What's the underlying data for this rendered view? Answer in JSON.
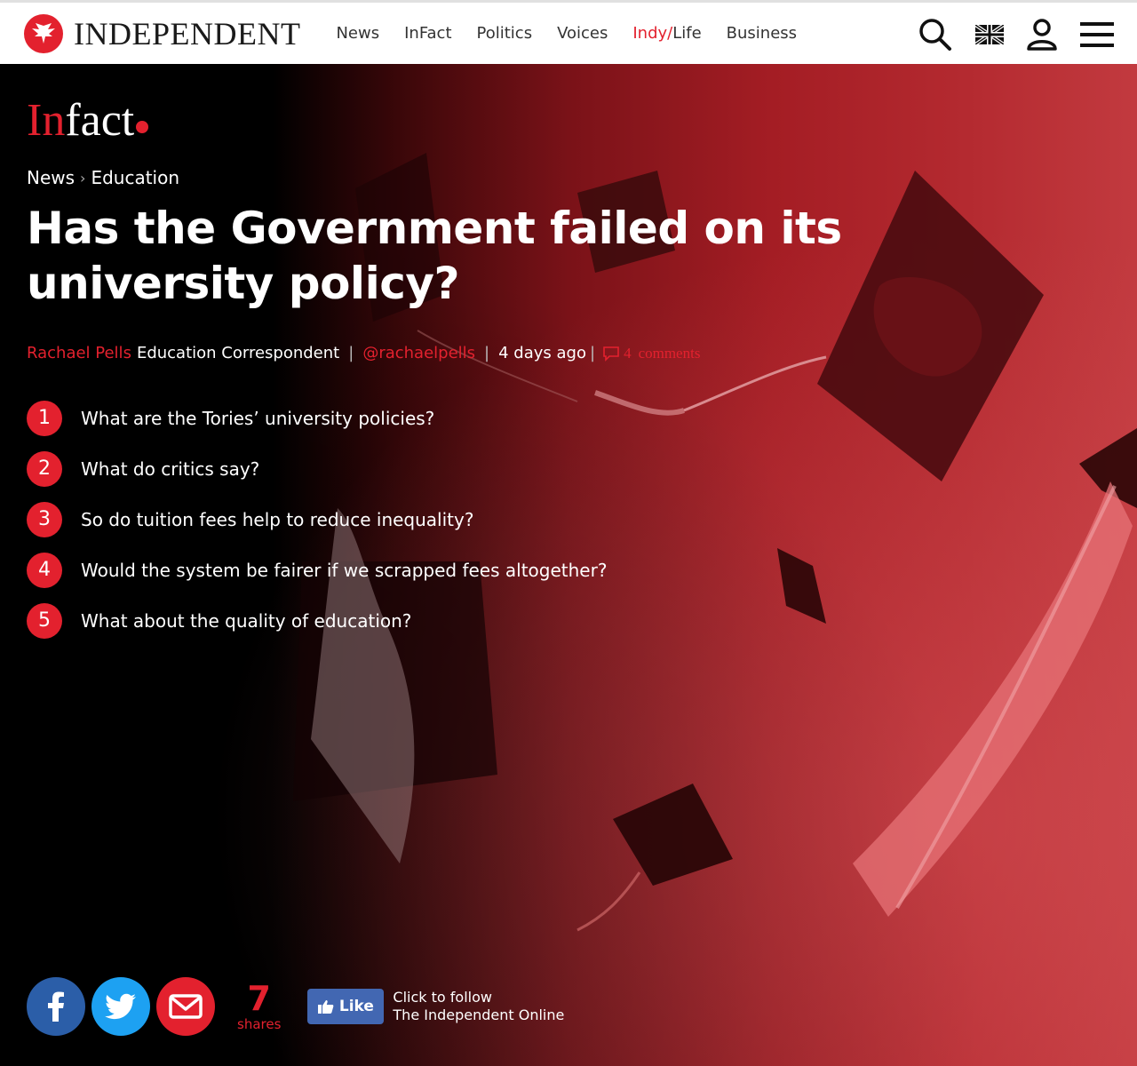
{
  "header": {
    "brand": "INDEPENDENT",
    "nav": [
      {
        "label": "News"
      },
      {
        "label": "InFact"
      },
      {
        "label": "Politics"
      },
      {
        "label": "Voices"
      },
      {
        "label_a": "Indy/",
        "label_b": "Life"
      },
      {
        "label": "Business"
      }
    ],
    "icons": [
      "search-icon",
      "uk-flag-icon",
      "user-icon",
      "menu-icon"
    ]
  },
  "infact_logo": {
    "red": "In",
    "rest": "fact"
  },
  "breadcrumb": {
    "section": "News",
    "sep": "›",
    "subsection": "Education"
  },
  "headline": "Has the Government failed on its university policy?",
  "byline": {
    "author": "Rachael Pells",
    "role": "Education Correspondent",
    "handle": "@rachaelpells",
    "time": "4 days ago",
    "comment_count": "4",
    "comment_label": "comments"
  },
  "toc": [
    {
      "num": "1",
      "text": "What are the Tories’ university policies?"
    },
    {
      "num": "2",
      "text": "What do critics say?"
    },
    {
      "num": "3",
      "text": "So do tuition fees help to reduce inequality?"
    },
    {
      "num": "4",
      "text": "Would the system be fairer if we scrapped fees altogether?"
    },
    {
      "num": "5",
      "text": "What about the quality of education?"
    }
  ],
  "share": {
    "count": "7",
    "label": "shares",
    "like": "Like",
    "follow_line1": "Click to follow",
    "follow_line2": "The Independent Online"
  },
  "colors": {
    "accent": "#e3212e",
    "facebook": "#2b5ea8",
    "twitter": "#1da1f2"
  }
}
